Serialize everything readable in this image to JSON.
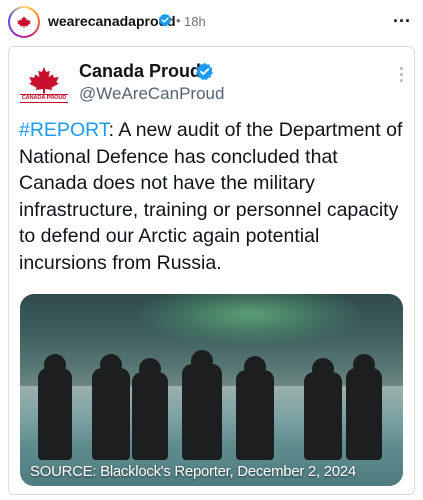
{
  "post": {
    "username": "wearecanadaproud",
    "separator": "•",
    "time": "18h",
    "more_label": "..."
  },
  "tweet": {
    "display_name": "Canada Proud",
    "handle": "@WeAreCanProud",
    "logo_text": "CANADA PROUD",
    "hashtag": "#REPORT",
    "body": ": A new audit of the Department of National Defence has concluded that Canada does not have the military infrastructure, training or personnel capacity to defend our Arctic again potential incursions from Russia."
  },
  "media": {
    "caption": "SOURCE: Blacklock's Reporter, December 2, 2024"
  },
  "colors": {
    "hashtag": "#1d9bf0",
    "verified": "#1d9bf0",
    "brand_red": "#c8102e"
  },
  "icons": {
    "verified": "verified-badge-icon",
    "more": "more-options-icon"
  }
}
